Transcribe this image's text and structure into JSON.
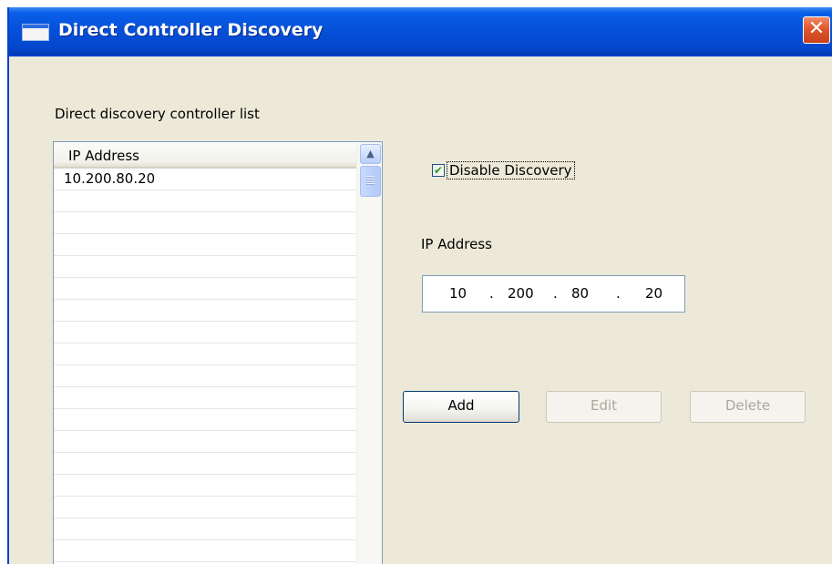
{
  "window": {
    "title": "Direct Controller Discovery",
    "close_glyph": "✕"
  },
  "list": {
    "caption": "Direct discovery controller list",
    "column_header": "IP Address",
    "rows": [
      "10.200.80.20",
      "",
      "",
      "",
      "",
      "",
      "",
      "",
      "",
      "",
      "",
      "",
      "",
      "",
      "",
      "",
      "",
      "",
      ""
    ]
  },
  "discovery": {
    "checkbox_label": "Disable Discovery",
    "checked": true,
    "check_glyph": "✔"
  },
  "ip_input": {
    "label": "IP Address",
    "octets": [
      "10",
      "200",
      "80",
      "20"
    ],
    "separator": "."
  },
  "buttons": {
    "add": "Add",
    "edit": "Edit",
    "delete": "Delete"
  },
  "icons": {
    "window": "app-window-icon",
    "close": "close-icon",
    "scroll_up": "scroll-up-arrow-icon",
    "scroll_thumb": "scrollbar-thumb"
  },
  "colors": {
    "titlebar": "#0550d8",
    "window_bg": "#ece9d8",
    "checkmark": "#21a121",
    "close_button": "#e0562c",
    "disabled_text": "#aca899"
  }
}
